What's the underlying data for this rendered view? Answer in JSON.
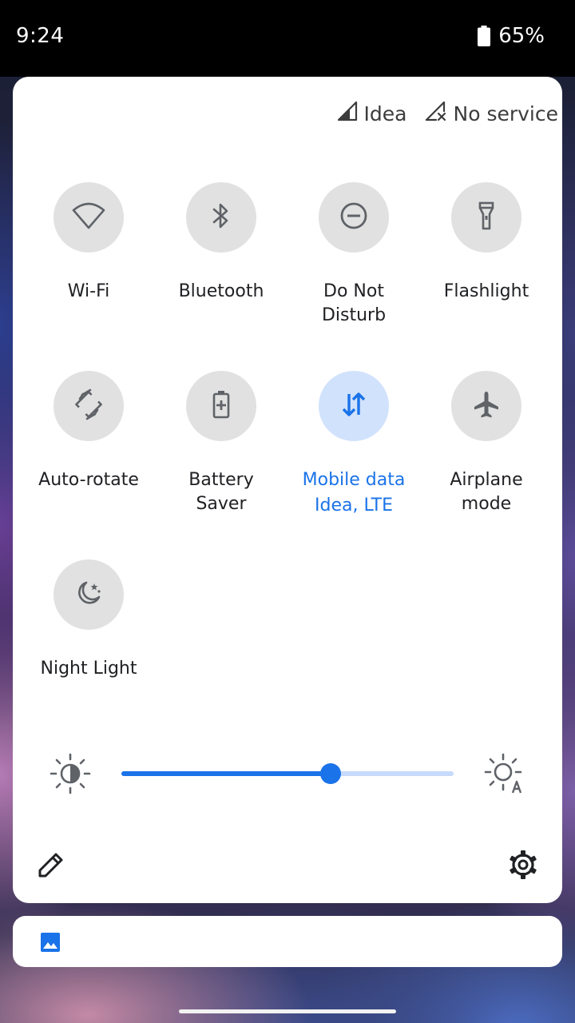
{
  "status_bar": {
    "time": "9:24",
    "battery_percent": "65%"
  },
  "carriers": [
    {
      "name": "Idea",
      "icon": "signal-icon"
    },
    {
      "name": "No service",
      "icon": "signal-no-service-icon"
    }
  ],
  "tiles": [
    {
      "label": "Wi-Fi",
      "icon": "wifi-icon",
      "active": false
    },
    {
      "label": "Bluetooth",
      "icon": "bluetooth-icon",
      "active": false
    },
    {
      "label": "Do Not\nDisturb",
      "icon": "do-not-disturb-icon",
      "active": false
    },
    {
      "label": "Flashlight",
      "icon": "flashlight-icon",
      "active": false
    },
    {
      "label": "Auto-rotate",
      "icon": "auto-rotate-icon",
      "active": false
    },
    {
      "label": "Battery\nSaver",
      "icon": "battery-saver-icon",
      "active": false
    },
    {
      "label": "Mobile data",
      "sublabel": "Idea, LTE",
      "icon": "mobile-data-icon",
      "active": true
    },
    {
      "label": "Airplane\nmode",
      "icon": "airplane-icon",
      "active": false
    },
    {
      "label": "Night Light",
      "icon": "night-light-icon",
      "active": false
    }
  ],
  "brightness": {
    "level": 0.63,
    "left_icon": "brightness-icon",
    "right_icon": "auto-brightness-icon"
  },
  "footer": {
    "edit_icon": "pencil-icon",
    "settings_icon": "gear-icon"
  },
  "notification": {
    "icon": "image-icon"
  },
  "colors": {
    "accent": "#1a73e8",
    "accent_light": "#d1e2fc",
    "tile_inactive": "#e1e1e1",
    "icon_gray": "#5f6368"
  }
}
